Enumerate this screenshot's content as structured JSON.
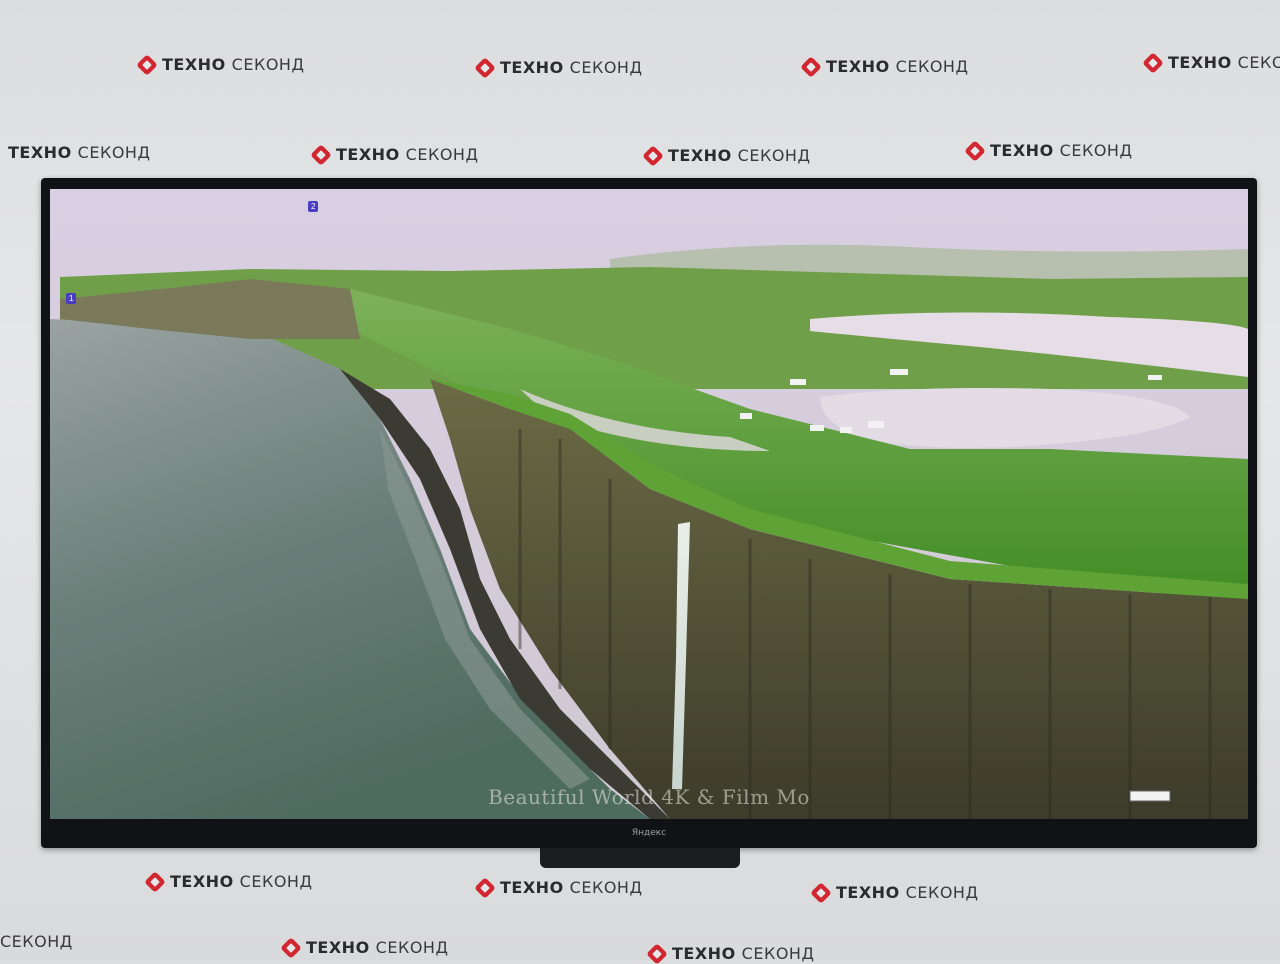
{
  "watermark": {
    "brand_bold": "ТЕХНО",
    "brand_light": "СЕКОНД",
    "accent": "#d22630"
  },
  "tv": {
    "bezel_logo": "Яндекс",
    "screen_caption": "Beautiful World 4K & Film Mo",
    "corner_tag_left": "2",
    "corner_tag_side": "1"
  },
  "scene": {
    "description_colors": {
      "sky": "#d8cfe0",
      "sea": "#5f7a72",
      "grass": "#4c9a2a",
      "cliff": "#5a5a3a",
      "lake": "#e4dbe6"
    }
  }
}
